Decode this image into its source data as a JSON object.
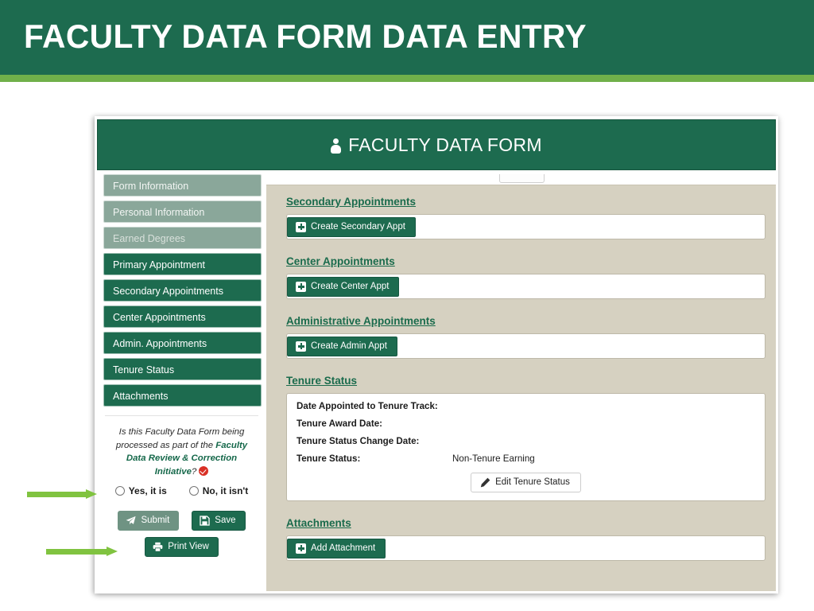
{
  "slide": {
    "title": "FACULTY DATA FORM DATA ENTRY",
    "banner_color": "#1d6b4f",
    "accent_color": "#70b04a"
  },
  "app": {
    "header_title": "FACULTY DATA FORM",
    "header_icon": "user-icon"
  },
  "sidebar": {
    "items": [
      {
        "label": "Form Information",
        "state": "muted"
      },
      {
        "label": "Personal Information",
        "state": "muted"
      },
      {
        "label": "Earned Degrees",
        "state": "muted-dim"
      },
      {
        "label": "Primary Appointment",
        "state": "active"
      },
      {
        "label": "Secondary Appointments",
        "state": "active"
      },
      {
        "label": "Center Appointments",
        "state": "active"
      },
      {
        "label": "Admin. Appointments",
        "state": "active"
      },
      {
        "label": "Tenure Status",
        "state": "active"
      },
      {
        "label": "Attachments",
        "state": "active"
      }
    ],
    "review_question": {
      "part1": "Is this Faculty Data Form being processed as part of the ",
      "emphasis": "Faculty Data Review & Correction Initiative",
      "part2": "?",
      "required_icon": "required-check-icon"
    },
    "radios": [
      {
        "label": "Yes, it is",
        "selected": false
      },
      {
        "label": "No, it isn't",
        "selected": false
      }
    ],
    "buttons": {
      "submit": {
        "label": "Submit",
        "icon": "paper-plane-icon",
        "disabled": true
      },
      "save": {
        "label": "Save",
        "icon": "floppy-disk-icon",
        "disabled": false
      },
      "print_view": {
        "label": "Print View",
        "icon": "printer-icon",
        "disabled": false
      }
    }
  },
  "content": {
    "sections": [
      {
        "title": "Secondary Appointments",
        "button": {
          "label": "Create Secondary Appt",
          "icon": "plus-square-icon"
        }
      },
      {
        "title": "Center Appointments",
        "button": {
          "label": "Create Center Appt",
          "icon": "plus-square-icon"
        }
      },
      {
        "title": "Administrative Appointments",
        "button": {
          "label": "Create Admin Appt",
          "icon": "plus-square-icon"
        }
      }
    ],
    "tenure": {
      "title": "Tenure Status",
      "rows": [
        {
          "label": "Date Appointed to Tenure Track:",
          "value": ""
        },
        {
          "label": "Tenure Award Date:",
          "value": ""
        },
        {
          "label": "Tenure Status Change Date:",
          "value": ""
        },
        {
          "label": "Tenure Status:",
          "value": "Non-Tenure Earning"
        }
      ],
      "edit_button": {
        "label": "Edit Tenure Status",
        "icon": "pencil-icon"
      }
    },
    "attachments": {
      "title": "Attachments",
      "button": {
        "label": "Add Attachment",
        "icon": "plus-square-icon"
      }
    }
  },
  "annotations": {
    "arrow_color": "#80c340",
    "arrows": [
      {
        "name": "arrow-to-review-question"
      },
      {
        "name": "arrow-to-print-view"
      }
    ]
  }
}
